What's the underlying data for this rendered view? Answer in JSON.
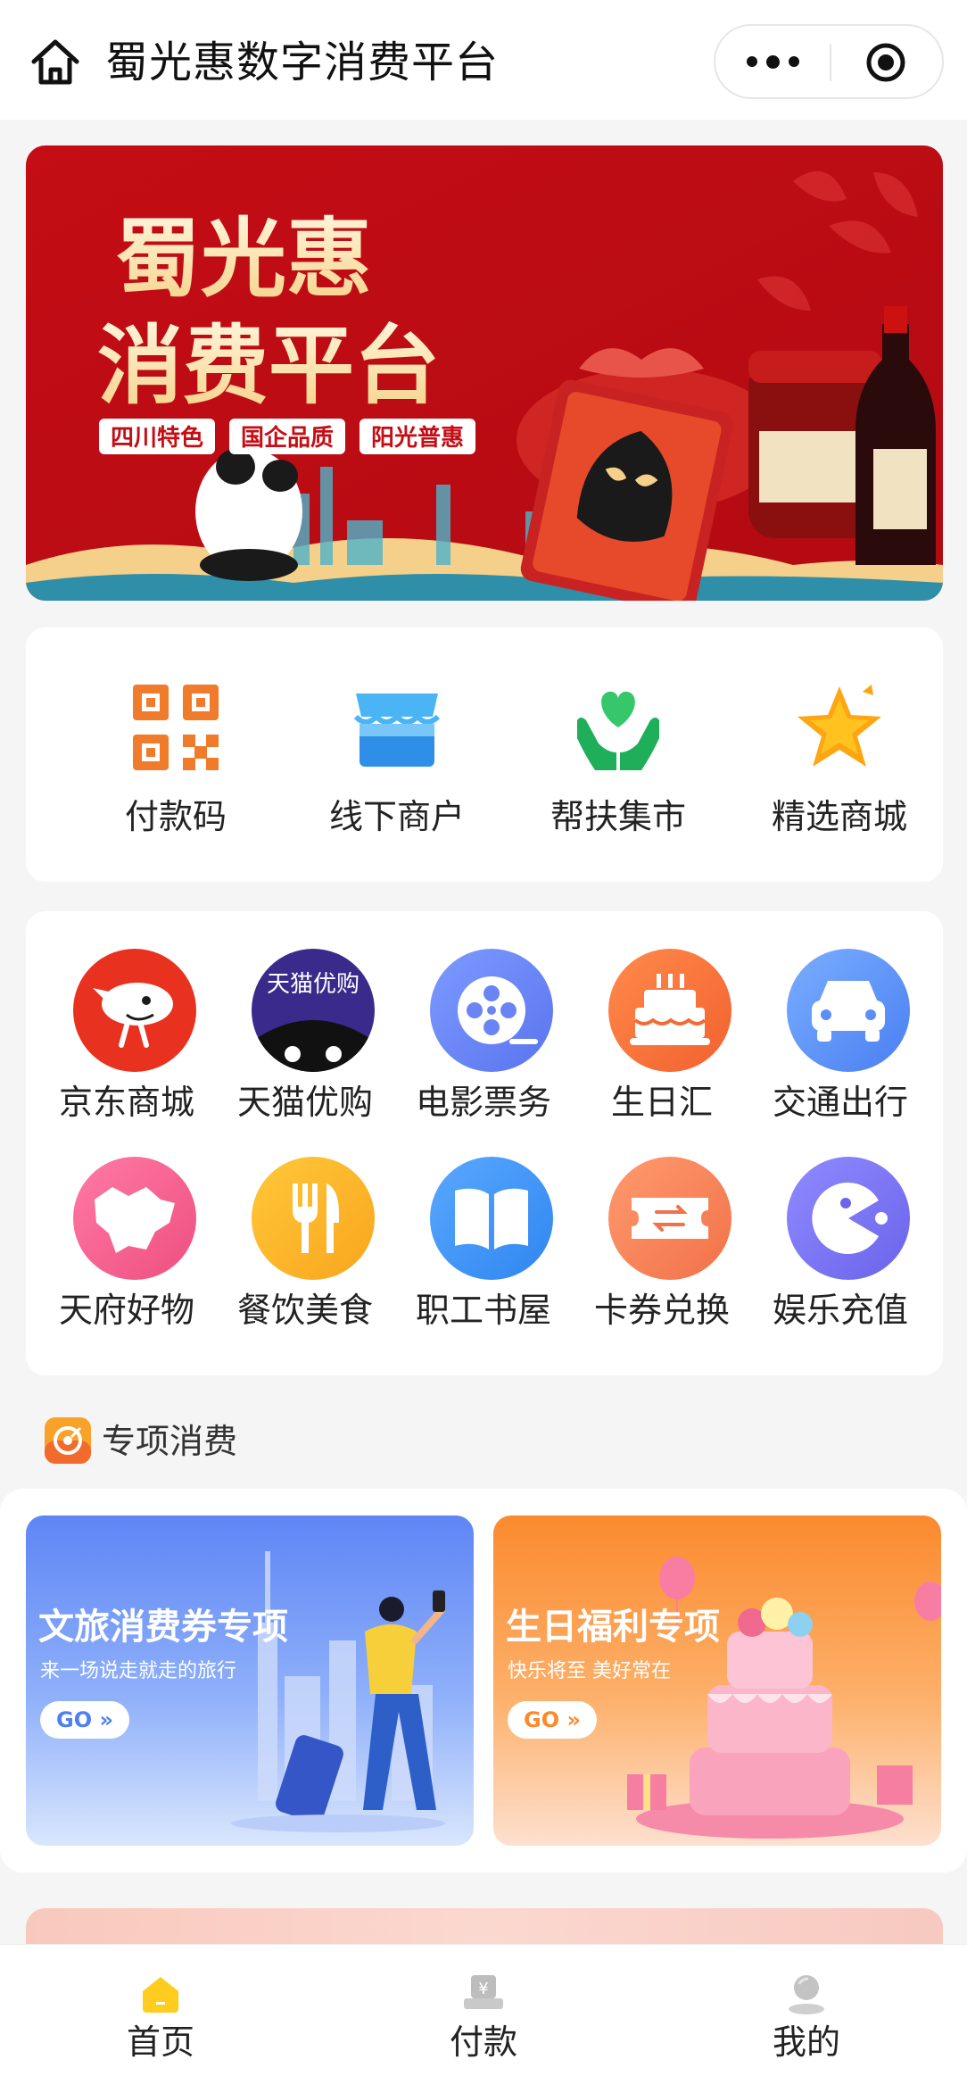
{
  "header": {
    "title": "蜀光惠数字消费平台"
  },
  "banner": {
    "title_line1": "蜀光惠",
    "title_line2": "消费平台",
    "tags": [
      "四川特色",
      "国企品质",
      "阳光普惠"
    ]
  },
  "quick_actions": [
    {
      "label": "付款码",
      "icon": "qrcode-icon"
    },
    {
      "label": "线下商户",
      "icon": "storefront-icon"
    },
    {
      "label": "帮扶集市",
      "icon": "heart-hands-icon"
    },
    {
      "label": "精选商城",
      "icon": "star-icon"
    }
  ],
  "services": [
    {
      "label": "京东商城",
      "icon": "jd-dog-icon",
      "color": "#e8321f"
    },
    {
      "label": "天猫优购",
      "icon": "tmall-cat-icon",
      "color": "#3a2a8c",
      "icon_text": "天猫优购"
    },
    {
      "label": "电影票务",
      "icon": "film-reel-icon",
      "color": "#6b8cf7"
    },
    {
      "label": "生日汇",
      "icon": "cake-icon",
      "color": "#f5743e"
    },
    {
      "label": "交通出行",
      "icon": "car-icon",
      "color": "#5b8ff7"
    },
    {
      "label": "天府好物",
      "icon": "sichuan-map-icon",
      "color": "#f3628f"
    },
    {
      "label": "餐饮美食",
      "icon": "fork-knife-icon",
      "color": "#fbb42b"
    },
    {
      "label": "职工书屋",
      "icon": "book-icon",
      "color": "#3d8ef5"
    },
    {
      "label": "卡券兑换",
      "icon": "ticket-exchange-icon",
      "color": "#f78758"
    },
    {
      "label": "娱乐充值",
      "icon": "game-icon",
      "color": "#7b74f0"
    }
  ],
  "special_section": {
    "title": "专项消费",
    "cards": [
      {
        "title": "文旅消费券专项",
        "subtitle": "来一场说走就走的旅行",
        "go": "GO »",
        "color": "#4f7ff2"
      },
      {
        "title": "生日福利专项",
        "subtitle": "快乐将至 美好常在",
        "go": "GO »",
        "color": "#fb8a2e"
      }
    ]
  },
  "tabbar": {
    "items": [
      {
        "label": "首页",
        "active": true,
        "icon": "home-icon"
      },
      {
        "label": "付款",
        "active": false,
        "icon": "payment-icon"
      },
      {
        "label": "我的",
        "active": false,
        "icon": "profile-icon"
      }
    ]
  },
  "colors": {
    "accent_red": "#d0131b",
    "accent_yellow": "#ffcc1f"
  }
}
